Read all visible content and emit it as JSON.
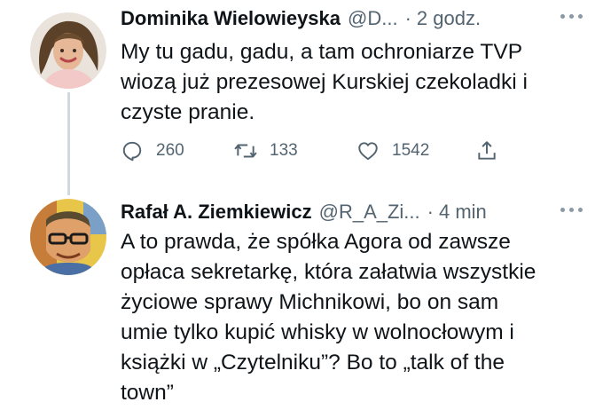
{
  "tweets": [
    {
      "author_name": "Dominika Wielowieyska",
      "author_handle": "@D...",
      "separator": "·",
      "time": "2 godz.",
      "text_lines": [
        "My tu gadu, gadu, a tam ochroniarze TVP",
        "wiozą już  prezesowej Kurskiej czekoladki i",
        "czyste pranie."
      ],
      "replies": "260",
      "retweets": "133",
      "likes": "1542"
    },
    {
      "author_name": "Rafał A. Ziemkiewicz",
      "author_handle": "@R_A_Zi...",
      "separator": "·",
      "time": "4 min",
      "text_lines": [
        "A to prawda, że spółka Agora od zawsze",
        "opłaca sekretarkę, która załatwia wszystkie",
        "życiowe sprawy Michnikowi, bo on sam",
        "umie tylko kupić whisky w wolnocłowym i",
        "książki w „Czytelniku”? Bo to „talk of the",
        "town”"
      ]
    }
  ],
  "icons": {
    "reply": "reply-icon",
    "retweet": "retweet-icon",
    "like": "like-icon",
    "share": "share-icon",
    "more": "more-options-icon"
  },
  "colors": {
    "text": "#0f1419",
    "secondary": "#536471",
    "thread_line": "#cfd9de"
  }
}
